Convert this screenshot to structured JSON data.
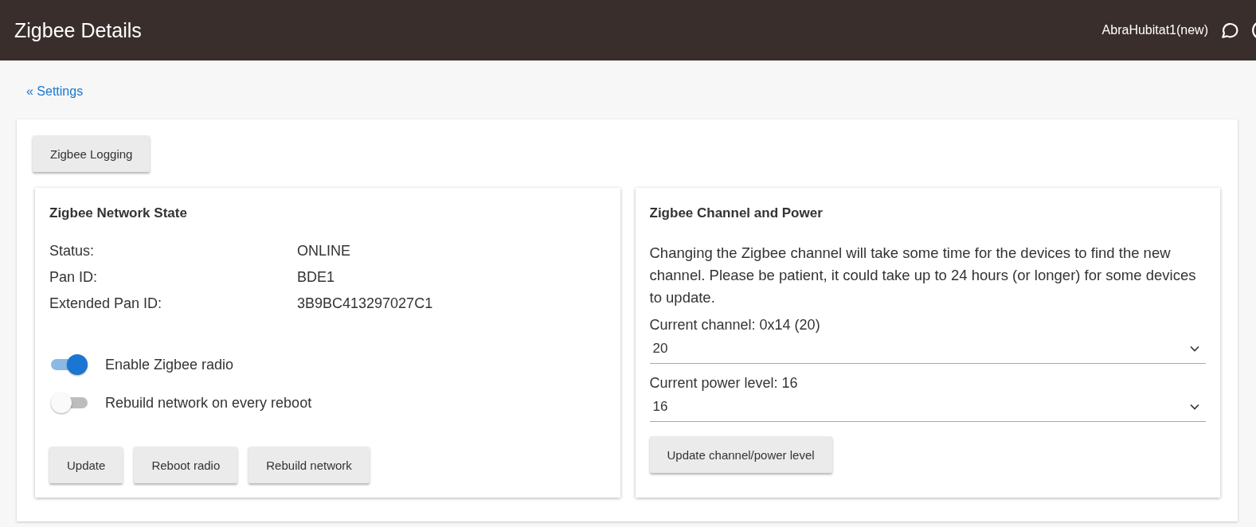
{
  "header": {
    "title": "Zigbee Details",
    "hub_name": "AbraHubitat1(new)"
  },
  "back_link": "« Settings",
  "logging_button": "Zigbee Logging",
  "network_state": {
    "title": "Zigbee Network State",
    "fields": [
      {
        "label": "Status:",
        "value": "ONLINE"
      },
      {
        "label": "Pan ID:",
        "value": "BDE1"
      },
      {
        "label": "Extended Pan ID:",
        "value": "3B9BC413297027C1"
      }
    ],
    "toggles": [
      {
        "label": "Enable Zigbee radio",
        "on": true
      },
      {
        "label": "Rebuild network on every reboot",
        "on": false
      }
    ],
    "buttons": [
      "Update",
      "Reboot radio",
      "Rebuild network"
    ]
  },
  "channel_power": {
    "title": "Zigbee Channel and Power",
    "description": "Changing the Zigbee channel will take some time for the devices to find the new channel. Please be patient, it could take up to 24 hours (or longer) for some devices to update.",
    "selects": [
      {
        "label": "Current channel: 0x14 (20)",
        "value": "20"
      },
      {
        "label": "Current power level: 16",
        "value": "16"
      }
    ],
    "button": "Update channel/power level"
  }
}
